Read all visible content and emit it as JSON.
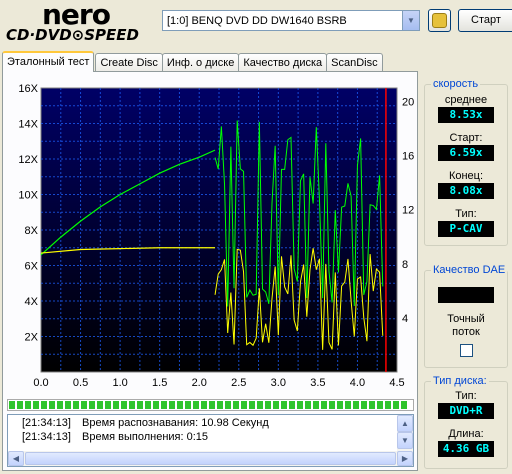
{
  "header": {
    "logo_text": "nero",
    "logo_sub": "CD·DVD⊙SPEED",
    "drive": "[1:0]  BENQ DVD DD DW1640 BSRB",
    "start_label": "Старт",
    "refresh_icon": "refresh-icon"
  },
  "tabs": [
    "Эталонный тест",
    "Create Disc",
    "Инф. о диске",
    "Качество диска",
    "ScanDisc"
  ],
  "speed": {
    "title": "скорость",
    "avg_label": "среднее",
    "avg_value": "8.53x",
    "start_label": "Старт:",
    "start_value": "6.59x",
    "end_label": "Конец:",
    "end_value": "8.08x",
    "type_label": "Тип:",
    "type_value": "P-CAV"
  },
  "dae": {
    "title": "Качество DAE",
    "value": "",
    "accurate_label_1": "Точный",
    "accurate_label_2": "поток",
    "accurate_checked": false
  },
  "disc": {
    "title": "Тип диска:",
    "type_label": "Тип:",
    "type_value": "DVD+R",
    "length_label": "Длина:",
    "length_value": "4.36 GB"
  },
  "progress": {
    "fraction": 1.0
  },
  "log": [
    {
      "time": "[21:34:13]",
      "text": "Время распознавания: 10.98 Секунд"
    },
    {
      "time": "[21:34:13]",
      "text": "Время выполнения: 0:15"
    }
  ],
  "colors": {
    "plot_bg_top": "#000066",
    "plot_bg_bottom": "#000000",
    "grid": "#1e62ff",
    "read_speed": "#00ff00",
    "spin_speed": "#ffff00",
    "end_marker": "#ff0000"
  },
  "chart_data": {
    "type": "line",
    "x_ticks": [
      "0.0",
      "0.5",
      "1.0",
      "1.5",
      "2.0",
      "2.5",
      "3.0",
      "3.5",
      "4.0",
      "4.5"
    ],
    "y_left_ticks": [
      "2X",
      "4X",
      "6X",
      "8X",
      "10X",
      "12X",
      "14X",
      "16X"
    ],
    "y_right_ticks": [
      "4",
      "8",
      "12",
      "16",
      "20"
    ],
    "xlim": [
      0,
      4.5
    ],
    "ylim_left": [
      0,
      16
    ],
    "ylim_right": [
      0,
      21
    ],
    "grid": true,
    "end_marker_x": 4.36,
    "series": [
      {
        "axis": "left",
        "x": [
          0.0,
          0.25,
          0.5,
          0.75,
          1.0,
          1.25,
          1.5,
          1.75,
          2.0,
          2.2
        ],
        "values": [
          6.6,
          7.6,
          8.5,
          9.3,
          10.0,
          10.6,
          11.2,
          11.7,
          12.1,
          12.5
        ]
      },
      {
        "axis": "left",
        "x": [
          0.0,
          0.5,
          1.0,
          1.5,
          2.0,
          2.2
        ],
        "values": [
          6.7,
          6.9,
          6.95,
          7.0,
          7.0,
          7.0
        ]
      }
    ]
  }
}
